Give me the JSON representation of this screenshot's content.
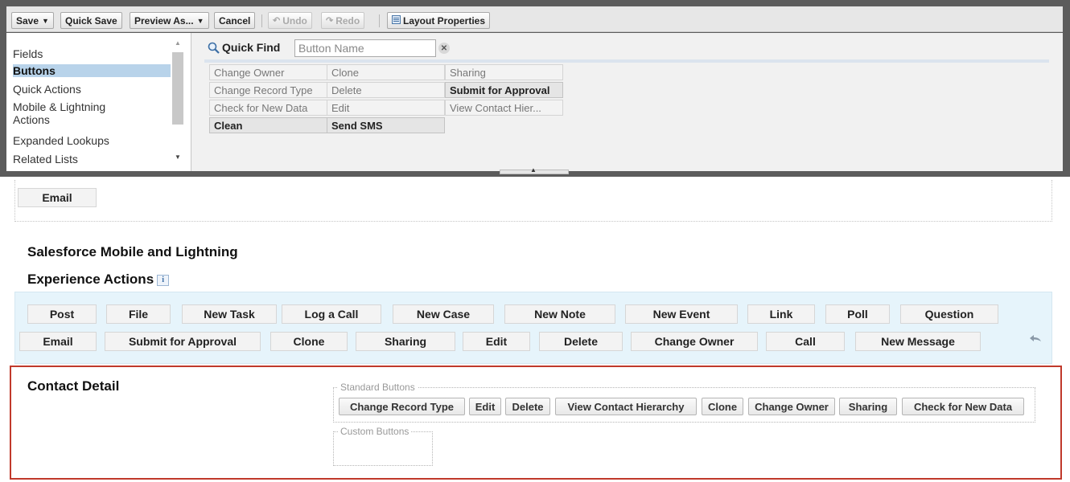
{
  "toolbar": {
    "save": "Save",
    "quick_save": "Quick Save",
    "preview_as": "Preview As...",
    "cancel": "Cancel",
    "undo": "Undo",
    "redo": "Redo",
    "layout_properties": "Layout Properties"
  },
  "palette": {
    "categories": [
      "Fields",
      "Buttons",
      "Quick Actions",
      "Mobile & Lightning",
      "Actions",
      "Expanded Lookups",
      "Related Lists"
    ],
    "selected_category": "Buttons",
    "quick_find_label": "Quick Find",
    "quick_find_placeholder": "Button Name",
    "buttons": [
      {
        "label": "Change Owner",
        "used": false
      },
      {
        "label": "Clone",
        "used": false
      },
      {
        "label": "Sharing",
        "used": false
      },
      {
        "label": "Change Record Type",
        "used": false
      },
      {
        "label": "Delete",
        "used": false
      },
      {
        "label": "Submit for Approval",
        "used": true
      },
      {
        "label": "Check for New Data",
        "used": false
      },
      {
        "label": "Edit",
        "used": false
      },
      {
        "label": "View Contact Hier...",
        "used": false
      },
      {
        "label": "Clean",
        "used": true
      },
      {
        "label": "Send SMS",
        "used": true
      }
    ]
  },
  "layout": {
    "email_button": "Email",
    "actions_section": {
      "title_line1": "Salesforce Mobile and Lightning",
      "title_line2": "Experience Actions",
      "info": "i",
      "row1": [
        "Post",
        "File",
        "New Task",
        "Log a Call",
        "New Case",
        "New Note",
        "New Event",
        "Link",
        "Poll",
        "Question"
      ],
      "row2": [
        "Email",
        "Submit for Approval",
        "Clone",
        "Sharing",
        "Edit",
        "Delete",
        "Change Owner",
        "Call",
        "New Message"
      ]
    },
    "detail_section": {
      "title": "Contact Detail",
      "standard_legend": "Standard Buttons",
      "standard_buttons": [
        "Change Record Type",
        "Edit",
        "Delete",
        "View Contact Hierarchy",
        "Clone",
        "Change Owner",
        "Sharing",
        "Check for New Data"
      ],
      "custom_legend": "Custom Buttons"
    }
  },
  "colors": {
    "palette_frame": "#5c5c5c",
    "selected_category": "#b8d3ea",
    "actions_background": "#e6f4fb",
    "detail_border": "#c0392b"
  }
}
